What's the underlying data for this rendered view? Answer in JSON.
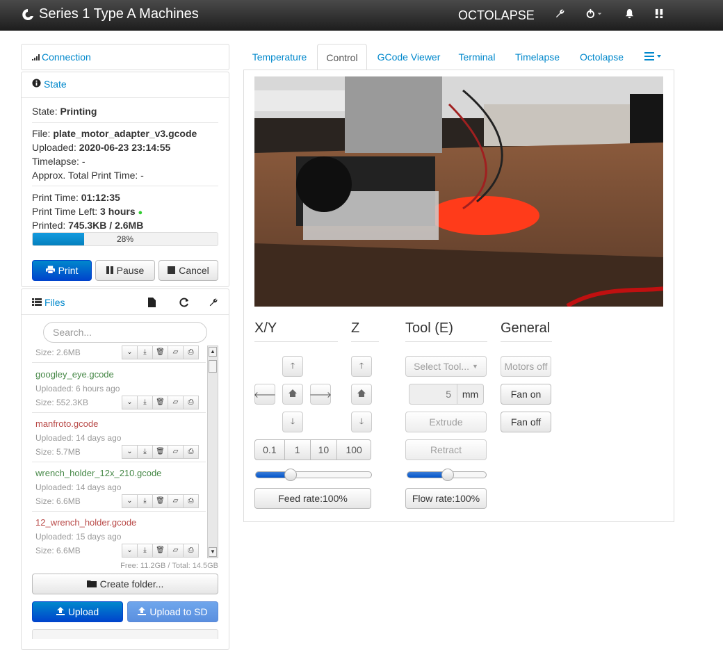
{
  "navbar": {
    "title": "Series 1 Type A Machines",
    "octolapse": "OCTOLAPSE"
  },
  "sidebar": {
    "connection": "Connection",
    "state": {
      "heading": "State",
      "state_label": "State:",
      "state_value": "Printing",
      "file_label": "File:",
      "file_value": "plate_motor_adapter_v3.gcode",
      "uploaded_label": "Uploaded:",
      "uploaded_value": "2020-06-23 23:14:55",
      "timelapse": "Timelapse: -",
      "approx": "Approx. Total Print Time: -",
      "print_time_label": "Print Time:",
      "print_time_value": "01:12:35",
      "time_left_label": "Print Time Left:",
      "time_left_value": "3 hours",
      "printed_label": "Printed:",
      "printed_value": "745.3KB / 2.6MB",
      "progress_pct": 28,
      "progress_text": "28%",
      "print_btn": "Print",
      "pause_btn": "Pause",
      "cancel_btn": "Cancel"
    },
    "files": {
      "heading": "Files",
      "search_placeholder": "Search...",
      "partial_size": "Size: 2.6MB",
      "items": [
        {
          "name": "googley_eye.gcode",
          "uploaded": "Uploaded: 6 hours ago",
          "size": "Size: 552.3KB",
          "color": "#468847"
        },
        {
          "name": "manfroto.gcode",
          "uploaded": "Uploaded: 14 days ago",
          "size": "Size: 5.7MB",
          "color": "#b94a48"
        },
        {
          "name": "wrench_holder_12x_210.gcode",
          "uploaded": "Uploaded: 14 days ago",
          "size": "Size: 6.6MB",
          "color": "#468847"
        },
        {
          "name": "12_wrench_holder.gcode",
          "uploaded": "Uploaded: 15 days ago",
          "size": "Size: 6.6MB",
          "color": "#b94a48"
        }
      ],
      "free": "Free: 11.2GB / Total: 14.5GB",
      "create_folder": "Create folder...",
      "upload": "Upload",
      "upload_sd": "Upload to SD"
    }
  },
  "tabs": [
    "Temperature",
    "Control",
    "GCode Viewer",
    "Terminal",
    "Timelapse",
    "Octolapse"
  ],
  "control": {
    "xy": "X/Y",
    "z": "Z",
    "tool": "Tool (E)",
    "general": "General",
    "steps": [
      "0.1",
      "1",
      "10",
      "100"
    ],
    "feed_rate": "Feed rate:100%",
    "feed_pct": 30,
    "select_tool": "Select Tool...",
    "extrude_amount": "5",
    "mm": "mm",
    "extrude": "Extrude",
    "retract": "Retract",
    "flow_rate": "Flow rate:100%",
    "flow_pct": 50,
    "motors_off": "Motors off",
    "fan_on": "Fan on",
    "fan_off": "Fan off"
  }
}
